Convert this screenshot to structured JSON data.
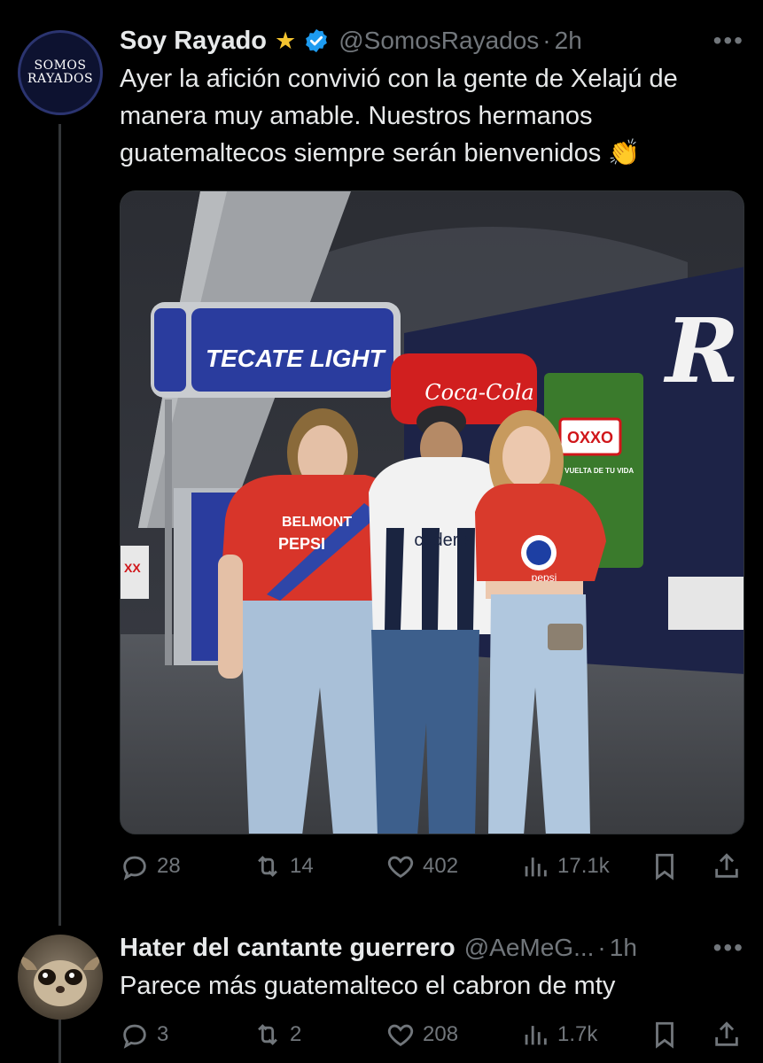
{
  "tweet1": {
    "avatar_text_top": "SOMOS",
    "avatar_text_bottom": "RAYADOS",
    "name": "Soy Rayado",
    "name_emoji": "★",
    "handle": "@SomosRayados",
    "separator": "·",
    "time": "2h",
    "more": "•••",
    "text": "Ayer la afición convivió con la gente de Xelajú de manera muy amable. Nuestros hermanos guatemaltecos siempre serán bienvenidos 👏",
    "media": {
      "sign_tecate": "TECATE LIGHT",
      "sign_cocacola": "Coca-Cola",
      "sign_oxxo": "OXXO",
      "sign_oxxo_tag": "A LA VUELTA DE TU VIDA",
      "wall_letter": "R",
      "shirt_sponsor_1": "BELMONT",
      "shirt_sponsor_2": "PEPSI",
      "shirt_sponsor_center": "codere",
      "shirt_sponsor_3": "pepsi",
      "side_sign": "XX"
    },
    "stats": {
      "replies": "28",
      "retweets": "14",
      "likes": "402",
      "views": "17.1k"
    }
  },
  "tweet2": {
    "name": "Hater del cantante guerrero",
    "handle": "@AeMeG...",
    "separator": "·",
    "time": "1h",
    "more": "•••",
    "text": "Parece más guatemalteco el cabron de mty",
    "stats": {
      "replies": "3",
      "retweets": "2",
      "likes": "208",
      "views": "1.7k"
    }
  },
  "icons": [
    "reply-icon",
    "retweet-icon",
    "like-icon",
    "views-icon",
    "bookmark-icon",
    "share-icon",
    "verified-badge-icon",
    "more-icon"
  ],
  "colors": {
    "background": "#000000",
    "text": "#e7e9ea",
    "muted": "#71767b",
    "verified": "#1d9bf0",
    "divider": "#333639"
  }
}
